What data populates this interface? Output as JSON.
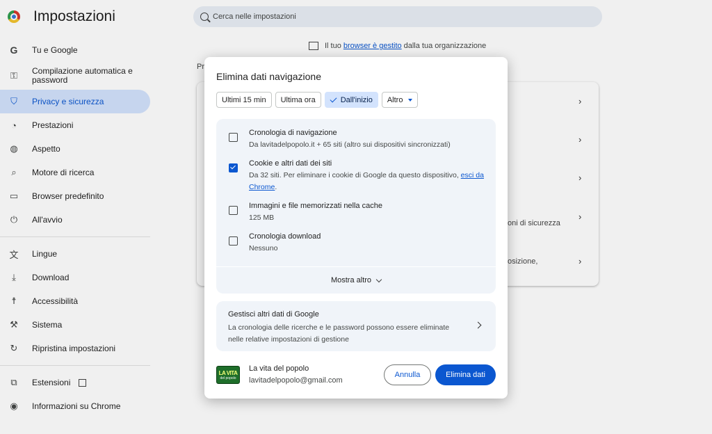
{
  "app": {
    "title": "Impostazioni",
    "search_placeholder": "Cerca nelle impostazioni"
  },
  "sidebar": {
    "items": [
      {
        "label": "Tu e Google",
        "icon": "google-g-icon"
      },
      {
        "label": "Compilazione automatica e password",
        "icon": "key-icon"
      },
      {
        "label": "Privacy e sicurezza",
        "icon": "shield-icon",
        "active": true
      },
      {
        "label": "Prestazioni",
        "icon": "speedometer-icon"
      },
      {
        "label": "Aspetto",
        "icon": "palette-icon"
      },
      {
        "label": "Motore di ricerca",
        "icon": "search-icon"
      },
      {
        "label": "Browser predefinito",
        "icon": "window-icon"
      },
      {
        "label": "All'avvio",
        "icon": "power-icon"
      }
    ],
    "items2": [
      {
        "label": "Lingue",
        "icon": "translate-icon"
      },
      {
        "label": "Download",
        "icon": "download-icon"
      },
      {
        "label": "Accessibilità",
        "icon": "accessibility-icon"
      },
      {
        "label": "Sistema",
        "icon": "wrench-icon"
      },
      {
        "label": "Ripristina impostazioni",
        "icon": "reset-icon"
      }
    ],
    "items3": [
      {
        "label": "Estensioni",
        "icon": "puzzle-icon"
      },
      {
        "label": "Informazioni su Chrome",
        "icon": "chrome-icon"
      }
    ]
  },
  "managed": {
    "prefix": "Il tuo",
    "link": "browser è gestito",
    "suffix": "dalla tua organizzazione"
  },
  "background": {
    "section_label": "Pr",
    "row_texts": [
      "oni di sicurezza",
      "osizione,"
    ]
  },
  "dialog": {
    "title": "Elimina dati navigazione",
    "time_ranges": [
      "Ultimi 15 min",
      "Ultima ora",
      "Dall'inizio",
      "Altro"
    ],
    "selected_range": "Dall'inizio",
    "options": [
      {
        "title": "Cronologia di navigazione",
        "desc": "Da lavitadelpopolo.it + 65 siti (altro sui dispositivi sincronizzati)",
        "checked": false
      },
      {
        "title": "Cookie e altri dati dei siti",
        "desc": "Da 32 siti. Per eliminare i cookie di Google da questo dispositivo,",
        "link": "esci da Chrome",
        "desc_end": ".",
        "checked": true
      },
      {
        "title": "Immagini e file memorizzati nella cache",
        "desc": "125 MB",
        "checked": false
      },
      {
        "title": "Cronologia download",
        "desc": "Nessuno",
        "checked": false
      }
    ],
    "show_more": "Mostra altro",
    "google_manage": {
      "title": "Gestisci altri dati di Google",
      "desc": "La cronologia delle ricerche e le password possono essere eliminate nelle relative impostazioni di gestione"
    },
    "account": {
      "avatar_text": "LA VITA",
      "avatar_sub": "del popolo",
      "name": "La vita del popolo",
      "email": "lavitadelpopolo@gmail.com"
    },
    "cancel_label": "Annulla",
    "delete_label": "Elimina dati"
  },
  "colors": {
    "accent": "#0b57d0",
    "selected_bg": "#d3e3fd",
    "panel_bg": "#f0f4f9"
  }
}
